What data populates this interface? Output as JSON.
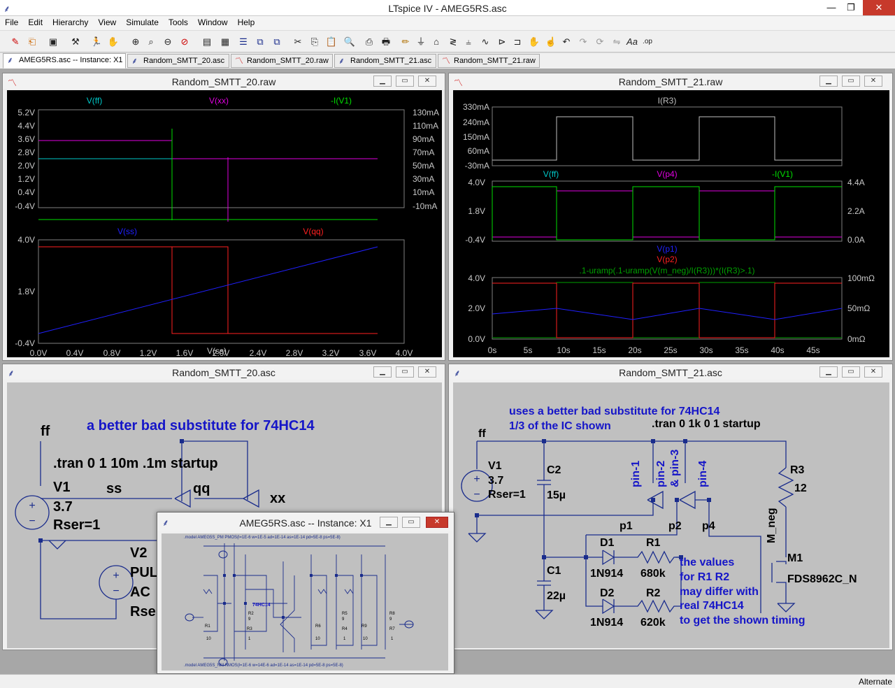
{
  "app": {
    "title": "LTspice IV - AMEG5RS.asc"
  },
  "menu": [
    "File",
    "Edit",
    "Hierarchy",
    "View",
    "Simulate",
    "Tools",
    "Window",
    "Help"
  ],
  "toolbar_icons": [
    "new-schematic-icon",
    "open-icon",
    "save-icon",
    "control-panel-icon",
    "run-icon",
    "halt-icon",
    "zoom-in-icon",
    "zoom-fit-icon",
    "zoom-out-icon",
    "zoom-cancel-icon",
    "autorange-icon",
    "tile-horizontal-icon",
    "tile-vertical-icon",
    "cascade-icon",
    "cut-icon",
    "copy-icon",
    "paste-icon",
    "find-icon",
    "print-setup-icon",
    "print-icon",
    "wire-icon",
    "ground-icon",
    "label-icon",
    "resistor-icon",
    "capacitor-icon",
    "inductor-icon",
    "diode-icon",
    "component-icon",
    "move-icon",
    "drag-icon",
    "undo-icon",
    "redo-icon",
    "rotate-icon",
    "mirror-icon",
    "text-icon",
    "spice-directive-icon"
  ],
  "tabs": [
    {
      "label": "AMEG5RS.asc -- Instance: X1",
      "kind": "schematic"
    },
    {
      "label": "Random_SMTT_20.asc",
      "kind": "schematic"
    },
    {
      "label": "Random_SMTT_20.raw",
      "kind": "waveform"
    },
    {
      "label": "Random_SMTT_21.asc",
      "kind": "schematic"
    },
    {
      "label": "Random_SMTT_21.raw",
      "kind": "waveform"
    }
  ],
  "windows": {
    "w20raw": {
      "title": "Random_SMTT_20.raw"
    },
    "w21raw": {
      "title": "Random_SMTT_21.raw"
    },
    "w20asc": {
      "title": "Random_SMTT_20.asc"
    },
    "w21asc": {
      "title": "Random_SMTT_21.asc"
    },
    "winst": {
      "title": "AMEG5RS.asc -- Instance: X1"
    }
  },
  "plot20": {
    "pane1": {
      "traces": [
        {
          "name": "V(ff)",
          "color": "#00c8c8"
        },
        {
          "name": "V(xx)",
          "color": "#e000e0"
        },
        {
          "name": "-I(V1)",
          "color": "#00e000"
        }
      ],
      "yleft": [
        "5.2V",
        "4.4V",
        "3.6V",
        "2.8V",
        "2.0V",
        "1.2V",
        "0.4V",
        "-0.4V"
      ],
      "yright": [
        "130mA",
        "110mA",
        "90mA",
        "70mA",
        "50mA",
        "30mA",
        "10mA",
        "-10mA"
      ]
    },
    "pane2": {
      "traces": [
        {
          "name": "V(ss)",
          "color": "#2020ff"
        },
        {
          "name": "V(qq)",
          "color": "#ff2020"
        }
      ],
      "yleft": [
        "4.0V",
        "1.8V",
        "-0.4V"
      ]
    },
    "xticks": [
      "0.0V",
      "0.4V",
      "0.8V",
      "1.2V",
      "1.6V",
      "2.0V",
      "2.4V",
      "2.8V",
      "3.2V",
      "3.6V",
      "4.0V"
    ],
    "xlabel": "V(ss)"
  },
  "plot21": {
    "pane1": {
      "traces": [
        {
          "name": "I(R3)",
          "color": "#c0c0c0"
        }
      ],
      "yleft": [
        "330mA",
        "240mA",
        "150mA",
        "60mA",
        "-30mA"
      ]
    },
    "pane2": {
      "traces": [
        {
          "name": "V(ff)",
          "color": "#00c8c8"
        },
        {
          "name": "V(p4)",
          "color": "#e000e0"
        },
        {
          "name": "-I(V1)",
          "color": "#00e000"
        }
      ],
      "yleft": [
        "4.0V",
        "1.8V",
        "-0.4V"
      ],
      "yright": [
        "4.4A",
        "2.2A",
        "0.0A"
      ]
    },
    "pane3": {
      "traces": [
        {
          "name": "V(p1)",
          "color": "#2020ff"
        },
        {
          "name": "V(p2)",
          "color": "#ff2020"
        },
        {
          "name": ".1-uramp(.1-uramp(V(m_neg)/I(R3)))*(I(R3)>.1)",
          "color": "#00a000"
        }
      ],
      "yleft": [
        "4.0V",
        "2.0V",
        "0.0V"
      ],
      "yright": [
        "100mΩ",
        "50mΩ",
        "0mΩ"
      ]
    },
    "xticks": [
      "0s",
      "5s",
      "10s",
      "15s",
      "20s",
      "25s",
      "30s",
      "35s",
      "40s",
      "45s"
    ]
  },
  "sch20": {
    "heading": "a better bad substitute for 74HC14",
    "directive": ".tran 0 1 10m .1m startup",
    "labels": {
      "ff": "ff",
      "ss": "ss",
      "qq": "qq",
      "xx": "xx"
    },
    "v1": {
      "name": "V1",
      "value": "3.7",
      "rser": "Rser=1"
    },
    "v2": {
      "name": "V2",
      "line1": "PUL",
      "line2": "AC",
      "line3": "Rse"
    }
  },
  "sch21": {
    "note1": "uses a better bad substitute for 74HC14",
    "note2": "1/3 of the IC shown",
    "directive": ".tran 0 1k 0 1 startup",
    "ff": "ff",
    "v1": {
      "name": "V1",
      "value": "3.7",
      "rser": "Rser=1"
    },
    "c2": {
      "name": "C2",
      "value": "15µ"
    },
    "c1": {
      "name": "C1",
      "value": "22µ"
    },
    "r3": {
      "name": "R3",
      "value": "12"
    },
    "pins": [
      "pin-1",
      "pin-2",
      "& pin-3",
      "pin-4"
    ],
    "nets": [
      "p1",
      "p2",
      "p4",
      "M_neg"
    ],
    "d1": {
      "name": "D1",
      "value": "1N914"
    },
    "d2": {
      "name": "D2",
      "value": "1N914"
    },
    "r1": {
      "name": "R1",
      "value": "680k"
    },
    "r2": {
      "name": "R2",
      "value": "620k"
    },
    "m1": {
      "name": "M1",
      "value": "FDS8962C_N"
    },
    "note3": [
      "the values",
      "for R1 R2",
      "may differ with",
      "real 74HC14",
      "to get the shown timing"
    ]
  },
  "inst": {
    "model_pm": ".model AMEG5S_PM PMOS(l=1E-6 w=1E-5 ad=1E-14 as=1E-14 pd=5E-8 ps=5E-8)",
    "model_nm": ".model AMEG5S_NM NMOS(l=1E-6 w=14E-6 ad=1E-14 as=1E-14 pd=5E-8 ps=5E-8)",
    "chip": "74HC14",
    "parts": [
      {
        "n": "R2",
        "v": "9"
      },
      {
        "n": "R3",
        "v": "1"
      },
      {
        "n": "R1",
        "v": "10"
      },
      {
        "n": "R5",
        "v": "9"
      },
      {
        "n": "R6",
        "v": "10"
      },
      {
        "n": "R4",
        "v": "1"
      },
      {
        "n": "R9",
        "v": "10"
      },
      {
        "n": "R8",
        "v": "9"
      },
      {
        "n": "R7",
        "v": "1"
      }
    ]
  },
  "status": {
    "text": "Alternate"
  }
}
